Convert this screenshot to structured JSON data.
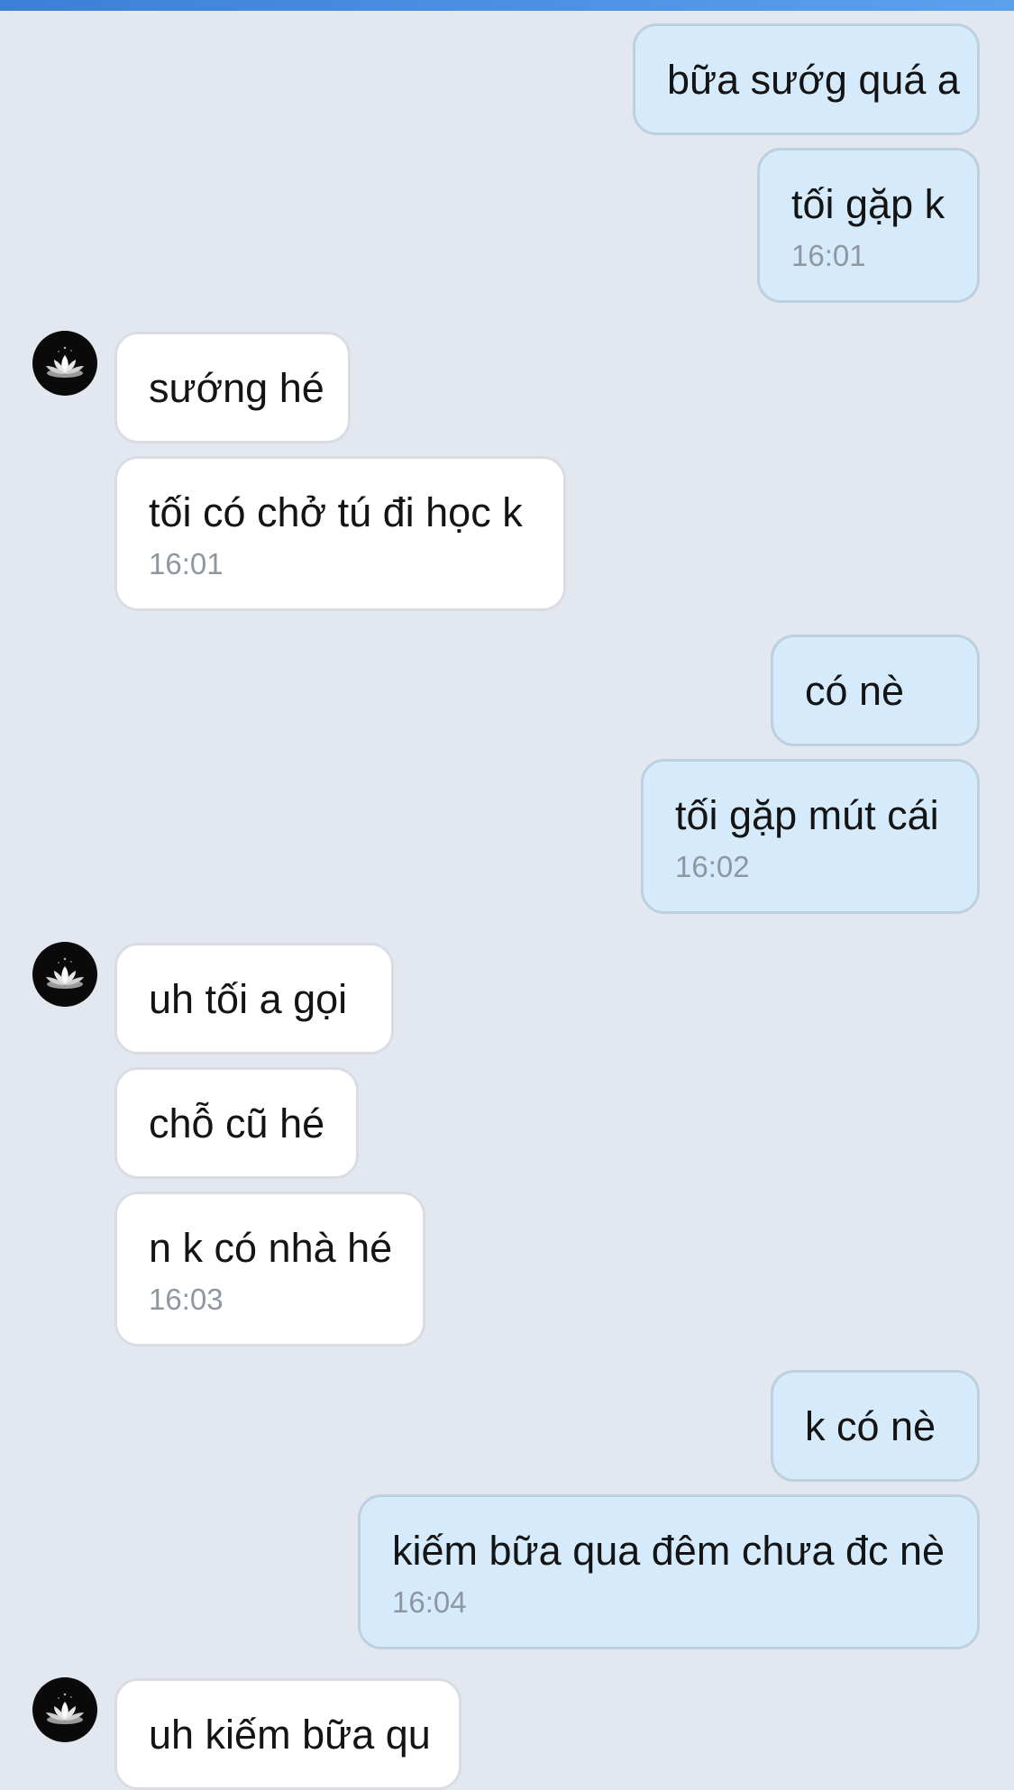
{
  "colors": {
    "outgoing_bubble": "#d5ebfb",
    "incoming_bubble": "#ffffff",
    "background": "#e3e7ef",
    "timestamp": "#8e97a1",
    "top_bar": "#4a90e2"
  },
  "avatar": {
    "icon": "white-lotus-icon"
  },
  "messages": [
    {
      "direction": "outgoing",
      "text": "bữa sướg quá a"
    },
    {
      "direction": "outgoing",
      "text": "tối gặp k",
      "time": "16:01"
    },
    {
      "direction": "incoming",
      "text": "sướng hé"
    },
    {
      "direction": "incoming",
      "text": "tối có chở tú đi học k",
      "time": "16:01"
    },
    {
      "direction": "outgoing",
      "text": "có nè"
    },
    {
      "direction": "outgoing",
      "text": "tối gặp mút cái",
      "time": "16:02"
    },
    {
      "direction": "incoming",
      "text": "uh tối a gọi"
    },
    {
      "direction": "incoming",
      "text": "chỗ cũ hé"
    },
    {
      "direction": "incoming",
      "text": "n k có nhà hé",
      "time": "16:03"
    },
    {
      "direction": "outgoing",
      "text": "k có nè"
    },
    {
      "direction": "outgoing",
      "text": "kiếm bữa qua đêm chưa đc nè",
      "time": "16:04"
    },
    {
      "direction": "incoming",
      "text": "uh kiếm bữa qu"
    }
  ]
}
